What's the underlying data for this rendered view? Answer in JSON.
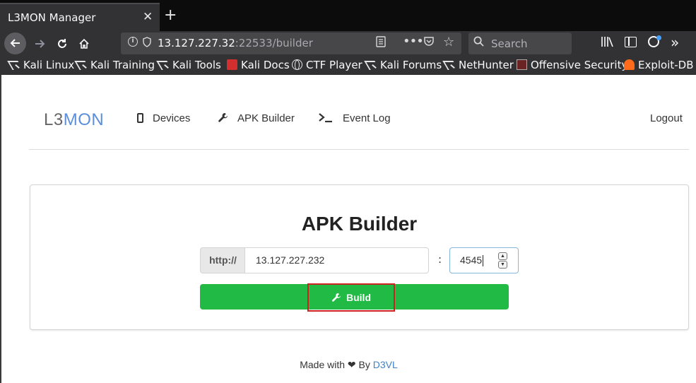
{
  "browser": {
    "tab_title": "L3MON Manager",
    "close_glyph": "✕",
    "newtab_glyph": "+",
    "url_host": "13.127.227.32",
    "url_rest": ":22533/builder",
    "search_placeholder": "Search",
    "bookmarks": [
      {
        "label": "Kali Linux",
        "icon": "kali-dragon-icon"
      },
      {
        "label": "Kali Training",
        "icon": "kali-dragon-icon"
      },
      {
        "label": "Kali Tools",
        "icon": "kali-dragon-icon"
      },
      {
        "label": "Kali Docs",
        "icon": "kali-docs-icon"
      },
      {
        "label": "CTF Player",
        "icon": "globe-icon"
      },
      {
        "label": "Kali Forums",
        "icon": "kali-dragon-icon"
      },
      {
        "label": "NetHunter",
        "icon": "kali-dragon-icon"
      },
      {
        "label": "Offensive Security",
        "icon": "offsec-icon"
      },
      {
        "label": "Exploit-DB",
        "icon": "exploit-db-icon"
      }
    ]
  },
  "app": {
    "logo_prefix": "L3",
    "logo_accent": "MON",
    "logo_accent_color": "#5b8fdc",
    "menu": {
      "devices": "Devices",
      "builder": "APK Builder",
      "events": "Event Log",
      "logout": "Logout"
    }
  },
  "builder": {
    "title": "APK Builder",
    "protocol_label": "http://",
    "host_value": "13.127.227.232",
    "separator": ":",
    "port_value": "4545",
    "build_label": "Build",
    "build_color": "#21ba45"
  },
  "footer": {
    "made_with": "Made with ❤ By",
    "author": "D3VL"
  }
}
